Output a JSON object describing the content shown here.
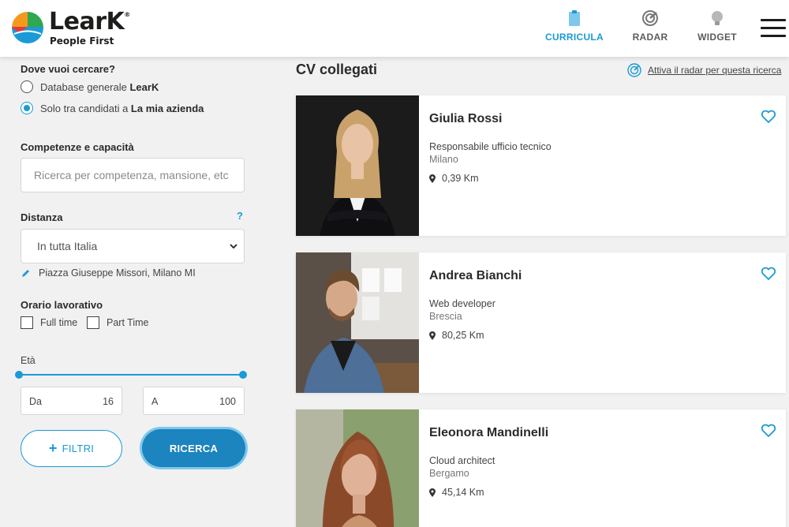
{
  "brand": {
    "name": "LearK",
    "tagline": "People First",
    "reg": "®"
  },
  "nav": [
    {
      "label": "CURRICULA",
      "icon": "clipboard-icon",
      "active": true
    },
    {
      "label": "RADAR",
      "icon": "radar-icon",
      "active": false
    },
    {
      "label": "WIDGET",
      "icon": "lightbulb-icon",
      "active": false
    }
  ],
  "colors": {
    "accent": "#1a9ad6",
    "button": "#1c84be"
  },
  "sidebar": {
    "where_label": "Dove vuoi cercare?",
    "option1_text": "Database generale ",
    "option1_bold": "LearK",
    "option2_text": "Solo tra candidati a ",
    "option2_bold": "La mia azienda",
    "selected_option": 2,
    "skills_label": "Competenze e capacità",
    "skills_placeholder": "Ricerca per competenza, mansione, etc",
    "distance_label": "Distanza",
    "distance_help": "?",
    "distance_value": "In tutta Italia",
    "address": "Piazza Giuseppe Missori, Milano MI",
    "schedule_label": "Orario lavorativo",
    "fulltime_label": "Full time",
    "parttime_label": "Part Time",
    "age_label": "Età",
    "age_from_label": "Da",
    "age_from_value": "16",
    "age_to_label": "A",
    "age_to_value": "100",
    "filters_button": "FILTRI",
    "search_button": "RICERCA"
  },
  "main": {
    "title": "CV collegati",
    "radar_link": "Attiva il radar per questa ricerca",
    "candidates": [
      {
        "name": "Giulia Rossi",
        "role": "Responsabile ufficio tecnico",
        "city": "Milano",
        "distance": "0,39 Km"
      },
      {
        "name": "Andrea Bianchi",
        "role": "Web developer",
        "city": "Brescia",
        "distance": "80,25 Km"
      },
      {
        "name": "Eleonora Mandinelli",
        "role": "Cloud architect",
        "city": "Bergamo",
        "distance": "45,14 Km"
      }
    ]
  }
}
